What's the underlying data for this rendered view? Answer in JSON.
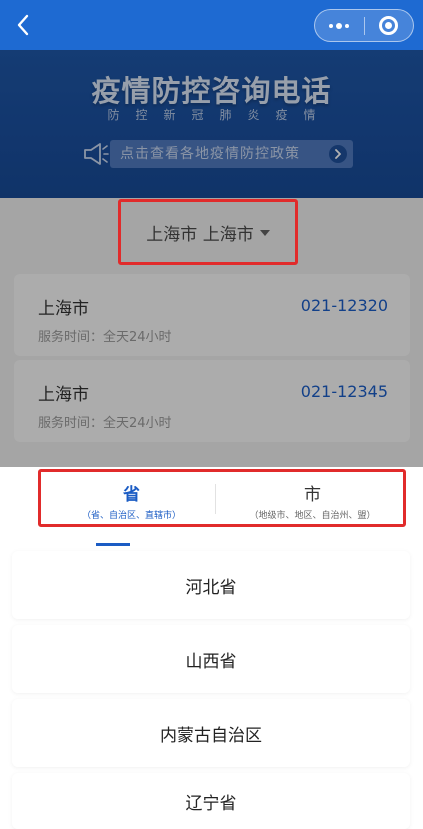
{
  "banner": {
    "title": "疫情防控咨询电话",
    "subtitle": "防控新冠肺炎疫情",
    "policy_button": "点击查看各地疫情防控政策"
  },
  "region": {
    "label": "上海市 上海市"
  },
  "hotlines": [
    {
      "name": "上海市",
      "phone": "021-12320",
      "hours": "服务时间：全天24小时"
    },
    {
      "name": "上海市",
      "phone": "021-12345",
      "hours": "服务时间：全天24小时"
    }
  ],
  "tabs": [
    {
      "title": "省",
      "sub": "（省、自治区、直辖市）",
      "active": true
    },
    {
      "title": "市",
      "sub": "（地级市、地区、自治州、盟）",
      "active": false
    }
  ],
  "provinces": [
    "河北省",
    "山西省",
    "内蒙古自治区",
    "辽宁省"
  ],
  "colors": {
    "navbar": "#1e6ad2",
    "accent": "#1b5cc4",
    "highlight_box": "#e12b2b"
  },
  "icons": {
    "back": "chevron-left-icon",
    "more": "more-dots-icon",
    "close_miniprogram": "target-icon",
    "megaphone": "megaphone-icon",
    "policy_arrow": "chevron-right-icon",
    "region_caret": "caret-down-icon"
  }
}
